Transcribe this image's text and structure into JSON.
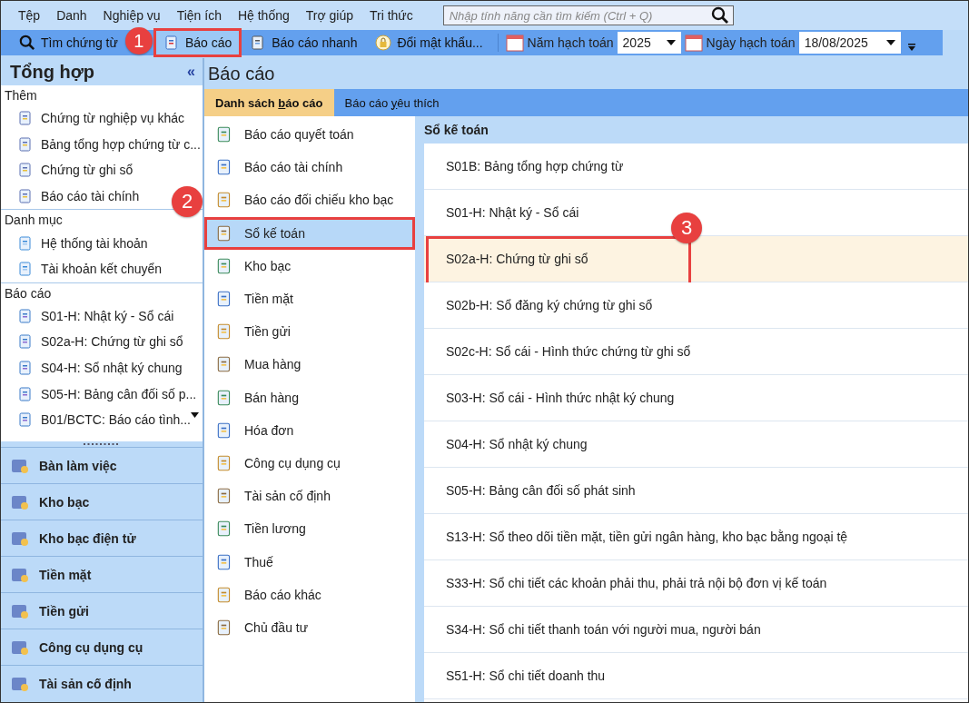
{
  "menu": [
    {
      "label": "Tệp"
    },
    {
      "label": "Danh"
    },
    {
      "label": "Nghiệp vụ"
    },
    {
      "label": "Tiện ích"
    },
    {
      "label": "Hệ thống"
    },
    {
      "label": "Trợ giúp"
    },
    {
      "label": "Tri thức"
    }
  ],
  "search": {
    "placeholder": "Nhập tính năng cần tìm kiếm (Ctrl + Q)"
  },
  "toolbar": [
    {
      "label": "Tìm chứng từ",
      "kind": "search"
    },
    {
      "label": "Báo cáo",
      "kind": "report",
      "callout": "1"
    },
    {
      "label": "Báo cáo nhanh",
      "kind": "quick"
    },
    {
      "label": "Đổi mật khẩu...",
      "kind": "lock"
    }
  ],
  "year": {
    "label": "Năm hạch toán",
    "value": "2025"
  },
  "date": {
    "label": "Ngày hạch toán",
    "value": "18/08/2025"
  },
  "sidebar": {
    "title": "Tổng hợp",
    "collapse": "«",
    "sections": [
      {
        "title": "Thêm",
        "kind": "add",
        "items": [
          "Chứng từ nghiệp vụ khác",
          "Bảng tổng hợp chứng từ c...",
          "Chứng từ ghi sổ",
          "Báo cáo tài chính"
        ]
      },
      {
        "title": "Danh mục",
        "kind": "catalog",
        "items": [
          "Hệ thống tài khoản",
          "Tài khoản kết chuyển"
        ]
      },
      {
        "title": "Báo cáo",
        "kind": "report",
        "items": [
          "S01-H: Nhật ký - Sổ cái",
          "S02a-H: Chứng từ ghi sổ",
          "S04-H: Sổ nhật ký chung",
          "S05-H: Bảng cân đối số p...",
          "B01/BCTC: Báo cáo tình..."
        ]
      }
    ],
    "modules": [
      "Bàn làm việc",
      "Kho bạc",
      "Kho bạc điện tử",
      "Tiền mặt",
      "Tiền gửi",
      "Công cụ dụng cụ",
      "Tài sản cố định"
    ]
  },
  "panel": {
    "title": "Báo cáo",
    "tabs": [
      {
        "label": "Danh sách **b**áo cáo",
        "selected": true
      },
      {
        "label": "Báo cáo **y**êu thích",
        "selected": false
      }
    ],
    "categories": [
      {
        "label": "Báo cáo quyết toán",
        "selected": false
      },
      {
        "label": "Báo cáo tài chính",
        "selected": false
      },
      {
        "label": "Báo cáo đối chiếu kho bạc",
        "selected": false
      },
      {
        "label": "Sổ kế toán",
        "selected": true,
        "callout": "2"
      },
      {
        "label": "Kho bạc",
        "selected": false
      },
      {
        "label": "Tiền mặt",
        "selected": false
      },
      {
        "label": "Tiền gửi",
        "selected": false
      },
      {
        "label": "Mua hàng",
        "selected": false
      },
      {
        "label": "Bán hàng",
        "selected": false
      },
      {
        "label": "Hóa đơn",
        "selected": false
      },
      {
        "label": "Công cụ dụng cụ",
        "selected": false
      },
      {
        "label": "Tài sản cố định",
        "selected": false
      },
      {
        "label": "Tiền lương",
        "selected": false
      },
      {
        "label": "Thuế",
        "selected": false
      },
      {
        "label": "Báo cáo khác",
        "selected": false
      },
      {
        "label": "Chủ đầu tư",
        "selected": false
      }
    ],
    "list_title": "Sổ kế toán",
    "reports": [
      {
        "label": "S01B: Bảng tổng hợp chứng từ",
        "selected": false
      },
      {
        "label": "S01-H: Nhật ký - Sổ cái",
        "selected": false
      },
      {
        "label": "S02a-H: Chứng từ ghi sổ",
        "selected": true,
        "callout": "3"
      },
      {
        "label": "S02b-H: Sổ đăng ký chứng từ ghi sổ",
        "selected": false
      },
      {
        "label": "S02c-H: Sổ cái - Hình thức chứng từ ghi sổ",
        "selected": false
      },
      {
        "label": "S03-H: Sổ cái - Hình thức nhật ký chung",
        "selected": false
      },
      {
        "label": "S04-H: Sổ nhật ký chung",
        "selected": false
      },
      {
        "label": "S05-H: Bảng cân đối số phát sinh",
        "selected": false
      },
      {
        "label": "S13-H: Sổ theo dõi tiền mặt, tiền gửi ngân hàng, kho bạc bằng ngoại tệ",
        "selected": false
      },
      {
        "label": "S33-H: Sổ chi tiết các khoản phải thu, phải trả nội bộ đơn vị kế toán",
        "selected": false
      },
      {
        "label": "S34-H: Sổ chi tiết thanh toán với người mua, người bán",
        "selected": false
      },
      {
        "label": "S51-H: Sổ chi tiết doanh thu",
        "selected": false
      }
    ]
  }
}
